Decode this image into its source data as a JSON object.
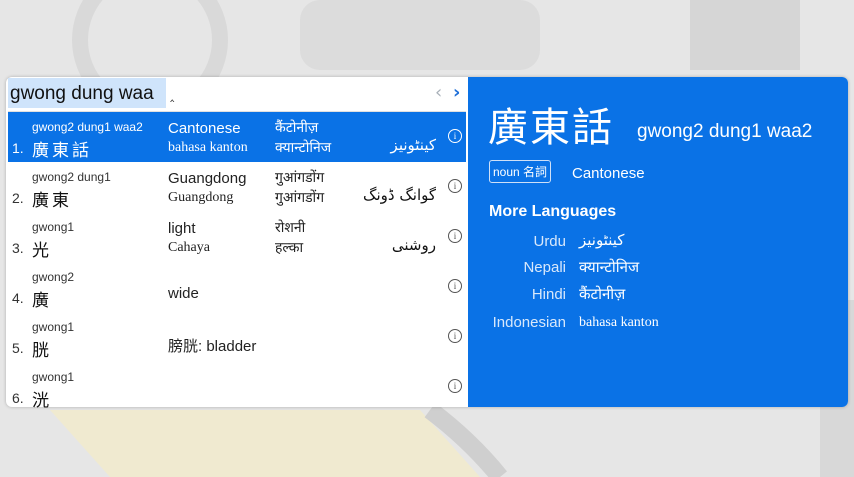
{
  "search": {
    "query": "gwong dung waa",
    "caret_glyph": "‸"
  },
  "nav": {
    "prev_glyph": "‹",
    "next_glyph": "›"
  },
  "results": [
    {
      "index": "1.",
      "pron": "gwong2 dung1 waa2",
      "hanzi": "廣東話",
      "english": "Cantonese",
      "indonesian": "bahasa kanton",
      "hindi": "कैंटोनीज़",
      "nepali": "क्यान्टोनिज",
      "urdu": "کینٹونیز",
      "selected": true
    },
    {
      "index": "2.",
      "pron": "gwong2 dung1",
      "hanzi": "廣東",
      "english": "Guangdong",
      "indonesian": "Guangdong",
      "hindi": "गुआंगडोंग",
      "nepali": "गुआंगडोंग",
      "urdu": "گوانگ ڈونگ",
      "selected": false
    },
    {
      "index": "3.",
      "pron": "gwong1",
      "hanzi": "光",
      "english": "light",
      "indonesian": "Cahaya",
      "hindi": "रोशनी",
      "nepali": "हल्का",
      "urdu": "روشنی",
      "selected": false
    },
    {
      "index": "4.",
      "pron": "gwong2",
      "hanzi": "廣",
      "english": "wide",
      "indonesian": "",
      "hindi": "",
      "nepali": "",
      "urdu": "",
      "selected": false
    },
    {
      "index": "5.",
      "pron": "gwong1",
      "hanzi": "胱",
      "english": "膀胱: bladder",
      "indonesian": "",
      "hindi": "",
      "nepali": "",
      "urdu": "",
      "selected": false
    },
    {
      "index": "6.",
      "pron": "gwong1",
      "hanzi": "洸",
      "english": "",
      "indonesian": "",
      "hindi": "",
      "nepali": "",
      "urdu": "",
      "selected": false
    }
  ],
  "info_glyph": "i",
  "detail": {
    "hanzi": "廣東話",
    "pron": "gwong2 dung1 waa2",
    "pos": "noun 名詞",
    "definition": "Cantonese",
    "more_title": "More Languages",
    "languages": [
      {
        "name": "Urdu",
        "value": "کینٹونیز"
      },
      {
        "name": "Nepali",
        "value": "क्यान्टोनिज"
      },
      {
        "name": "Hindi",
        "value": "कैंटोनीज़"
      },
      {
        "name": "Indonesian",
        "value": "bahasa kanton"
      }
    ]
  },
  "colors": {
    "accent": "#0a72e6",
    "selection": "#cfe4fb",
    "background": "#e6e6e6"
  }
}
